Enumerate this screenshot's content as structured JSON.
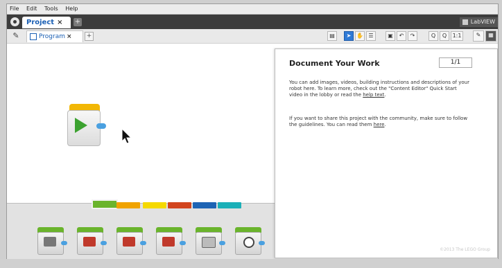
{
  "menu": [
    "File",
    "Edit",
    "Tools",
    "Help"
  ],
  "project_tab": {
    "label": "Project",
    "close": "×",
    "add": "+"
  },
  "labview_badge": "LabVIEW",
  "program_tab": {
    "label": "Program",
    "close": "×",
    "add": "+"
  },
  "toolbar": {
    "zoom_in": "Q",
    "zoom_out": "Q",
    "fit": "1:1"
  },
  "content_editor": {
    "title": "Document Your Work",
    "page": "1/1",
    "para1_text": "You can add images, videos, building instructions and descriptions of your robot here. To learn more, check out the \"Content Editor\" Quick Start video in the lobby or read the ",
    "para1_link": "help text",
    "para1_end": ".",
    "para2_text": "If you want to share this project with the community, make sure to follow the guidelines. You can read them ",
    "para2_link": "here",
    "para2_end": ".",
    "copyright": "©2013 The LEGO Group"
  },
  "palette": {
    "tab_colors": [
      "#6ab42c",
      "#f0a300",
      "#f5d900",
      "#d2451e",
      "#1e64b4",
      "#1bb0b8"
    ],
    "blocks": [
      "medium-motor-block",
      "large-motor-block",
      "move-steering-block",
      "move-tank-block",
      "display-block",
      "sound-block"
    ]
  }
}
